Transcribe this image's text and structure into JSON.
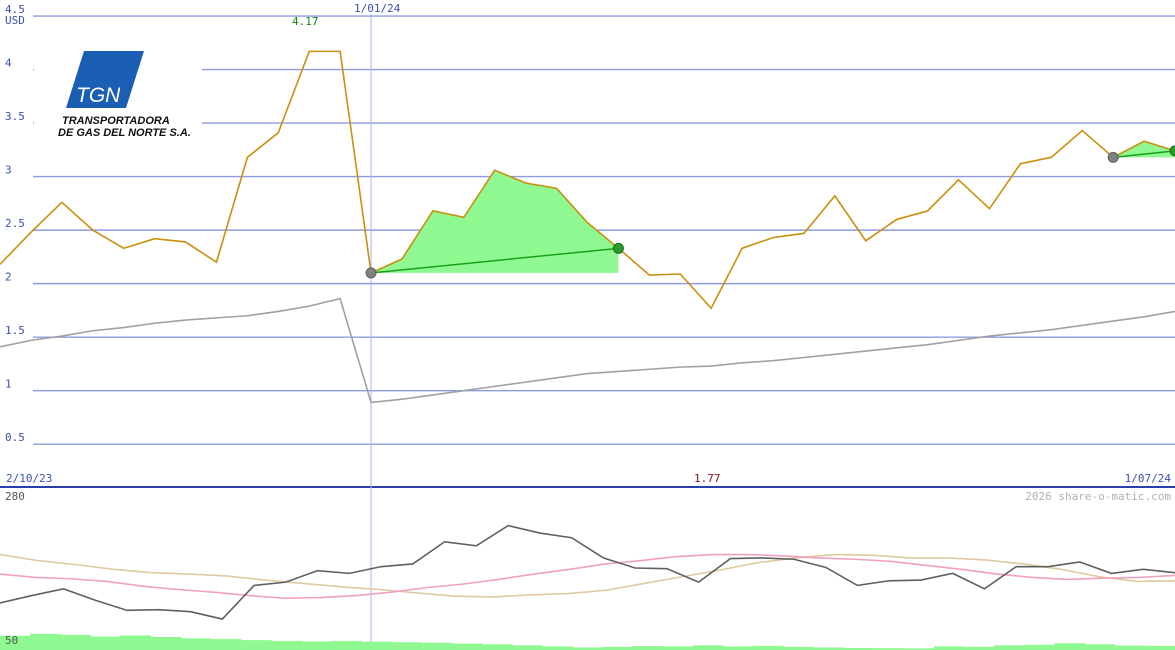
{
  "chart_data": {
    "type": "line",
    "currency": "USD",
    "y_ticks": [
      "4.5",
      "4",
      "3.5",
      "3",
      "2.5",
      "2",
      "1.5",
      "1",
      "0.5"
    ],
    "ylim": [
      0.1,
      4.65
    ],
    "x_start": "2/10/23",
    "x_end": "1/07/24",
    "marker_date": "1/01/24",
    "peak_label": "4.17",
    "trough_label": "1.77",
    "series": [
      {
        "color": "#c8900c",
        "values": [
          2.18,
          2.48,
          2.76,
          2.5,
          2.33,
          2.42,
          2.39,
          2.2,
          3.18,
          3.41,
          4.17,
          4.17,
          2.1,
          2.23,
          2.68,
          2.62,
          3.06,
          2.94,
          2.89,
          2.57,
          2.33,
          2.08,
          2.09,
          1.77,
          2.33,
          2.43,
          2.47,
          2.82,
          2.4,
          2.6,
          2.68,
          2.97,
          2.7,
          3.12,
          3.18,
          3.43,
          3.18,
          3.33,
          3.24
        ]
      },
      {
        "color": "#a0a0a0",
        "values": [
          1.41,
          1.47,
          1.51,
          1.56,
          1.59,
          1.63,
          1.66,
          1.68,
          1.7,
          1.74,
          1.79,
          1.86,
          0.89,
          0.92,
          0.96,
          1.0,
          1.04,
          1.08,
          1.12,
          1.16,
          1.18,
          1.2,
          1.22,
          1.23,
          1.26,
          1.28,
          1.31,
          1.34,
          1.37,
          1.4,
          1.43,
          1.47,
          1.51,
          1.54,
          1.57,
          1.61,
          1.65,
          1.69,
          1.74
        ]
      }
    ],
    "highlights": [
      {
        "from": 12,
        "to": 20
      },
      {
        "from": 36,
        "to": 38
      }
    ],
    "lower_panel": {
      "top_label": "280",
      "bottom_label": "50",
      "ylim": [
        50,
        285
      ],
      "series": [
        {
          "color": "#606060",
          "values": [
            117,
            128,
            138,
            121,
            106,
            107,
            104,
            93,
            143,
            148,
            165,
            161,
            171,
            175,
            208,
            202,
            232,
            221,
            214,
            184,
            169,
            168,
            148,
            183,
            184,
            182,
            170,
            143,
            150,
            151,
            161,
            138,
            171,
            171,
            178,
            161,
            167,
            162
          ]
        },
        {
          "color": "#f0a0c0",
          "values": [
            160,
            155,
            153,
            149,
            142,
            137,
            133,
            128,
            124,
            125,
            128,
            133,
            140,
            145,
            152,
            160,
            167,
            175,
            180,
            186,
            189,
            189,
            187,
            184,
            182,
            179,
            173,
            167,
            160,
            155,
            152,
            154,
            155,
            158
          ]
        },
        {
          "color": "#e0c8a0",
          "values": [
            189,
            180,
            174,
            167,
            162,
            160,
            157,
            151,
            146,
            141,
            137,
            132,
            127,
            126,
            129,
            131,
            136,
            146,
            156,
            166,
            177,
            184,
            189,
            188,
            184,
            184,
            181,
            175,
            167,
            156,
            149,
            150
          ]
        }
      ],
      "volume": [
        0.55,
        0.62,
        0.58,
        0.52,
        0.56,
        0.5,
        0.45,
        0.42,
        0.38,
        0.35,
        0.33,
        0.35,
        0.32,
        0.3,
        0.28,
        0.25,
        0.22,
        0.18,
        0.14,
        0.1,
        0.12,
        0.15,
        0.14,
        0.18,
        0.14,
        0.16,
        0.12,
        0.1,
        0.08,
        0.07,
        0.06,
        0.14,
        0.12,
        0.18,
        0.2,
        0.26,
        0.22,
        0.17,
        0.16
      ]
    },
    "grid": true
  },
  "logo": {
    "mark_text": "TGN",
    "line1": "TRANSPORTADORA",
    "line2": "DE GAS DEL NORTE S.A."
  },
  "footer": {
    "credit": "2026 share-o-matic.com"
  },
  "colors": {
    "grid": "#8d9ce0",
    "axis_text": "#3a4fb0",
    "highlight_fill": "#90f890",
    "trend_line": "#18a018",
    "marker": "#808080",
    "marker_end": "#2a9a2a",
    "logo_blue": "#1a5fb4",
    "volume": "#90f890"
  }
}
